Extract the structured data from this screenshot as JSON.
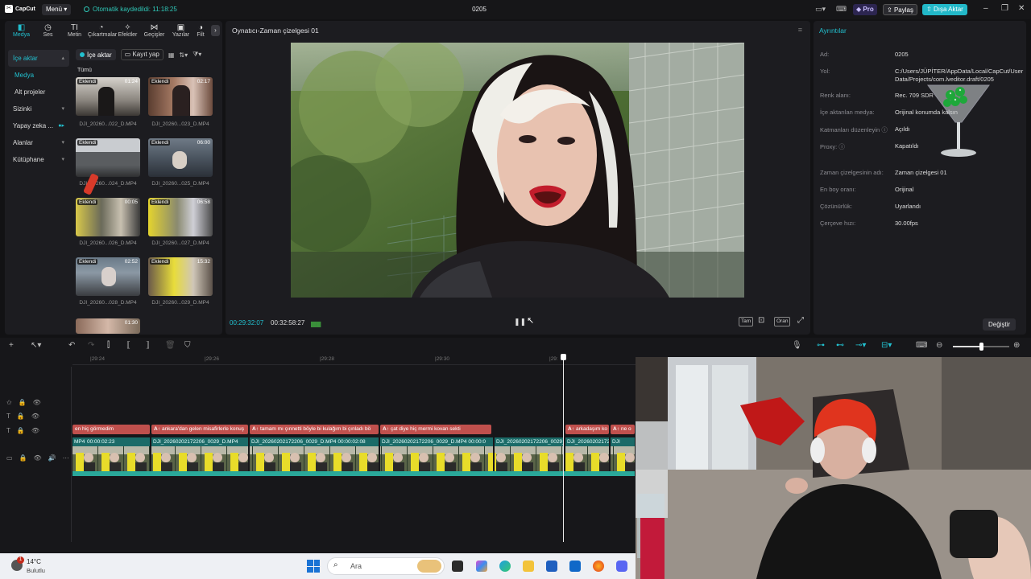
{
  "app": {
    "logo": "CapCut",
    "menu_label": "Menü",
    "autosave": "Otomatik kaydedildi: 11:18:25",
    "project_title": "0205",
    "pro_label": "Pro",
    "share_label": "Paylaş",
    "export_label": "Dışa Aktar"
  },
  "toolbar": {
    "items": [
      {
        "label": "Medya",
        "icon": "media-icon"
      },
      {
        "label": "Ses",
        "icon": "audio-icon"
      },
      {
        "label": "Metin",
        "icon": "text-icon"
      },
      {
        "label": "Çıkartmalar",
        "icon": "sticker-icon"
      },
      {
        "label": "Efektler",
        "icon": "effects-icon"
      },
      {
        "label": "Geçişler",
        "icon": "transitions-icon"
      },
      {
        "label": "Yazılar",
        "icon": "captions-icon"
      },
      {
        "label": "Filt",
        "icon": "filter-icon"
      }
    ]
  },
  "sidebar": {
    "items": [
      {
        "label": "İçe aktar"
      },
      {
        "label": "Medya"
      },
      {
        "label": "Alt projeler"
      },
      {
        "label": "Sizinki"
      },
      {
        "label": "Yapay zeka ..."
      },
      {
        "label": "Alanlar"
      },
      {
        "label": "Kütüphane"
      }
    ]
  },
  "media": {
    "import_label": "İçe aktar",
    "record_label": "Kayıt yap",
    "filter_label": "Tümü",
    "clips": [
      {
        "badge": "Eklendi",
        "duration": "01:24",
        "name": "DJI_20260...022_D.MP4"
      },
      {
        "badge": "Eklendi",
        "duration": "02:17",
        "name": "DJI_20260...023_D.MP4"
      },
      {
        "badge": "Eklendi",
        "duration": "",
        "name": "DJI_20260...024_D.MP4"
      },
      {
        "badge": "Eklendi",
        "duration": "06:00",
        "name": "DJI_20260...025_D.MP4"
      },
      {
        "badge": "Eklendi",
        "duration": "00:05",
        "name": "DJI_20260...026_D.MP4"
      },
      {
        "badge": "Eklendi",
        "duration": "06:58",
        "name": "DJI_20260...027_D.MP4"
      },
      {
        "badge": "Eklendi",
        "duration": "02:52",
        "name": "DJI_20260...028_D.MP4"
      },
      {
        "badge": "Eklendi",
        "duration": "15:32",
        "name": "DJI_20260...029_D.MP4"
      },
      {
        "badge": "",
        "duration": "01:30",
        "name": ""
      }
    ]
  },
  "player": {
    "title": "Oynatıcı-Zaman çizelgesi 01",
    "current_time": "00:29:32:07",
    "total_time": "00:32:58:27",
    "full_label": "Tam",
    "ratio_label": "Oran"
  },
  "details": {
    "title": "Ayrıntılar",
    "rows": [
      {
        "key": "Ad:",
        "value": "0205"
      },
      {
        "key": "Yol:",
        "value": "C:/Users/JÜPİTER/AppData/Local/CapCut/User Data/Projects/com.lveditor.draft/0205"
      },
      {
        "key": "Renk alanı:",
        "value": "Rec. 709 SDR"
      },
      {
        "key": "İçe aktarılan medya:",
        "value": "Orijinal konumda kalsın"
      },
      {
        "key": "Katmanları düzenleyin",
        "value": "Açıldı"
      },
      {
        "key": "Proxy:",
        "value": "Kapatıldı"
      },
      {
        "key": "Zaman çizelgesinin adı:",
        "value": "Zaman çizelgesi 01"
      },
      {
        "key": "En boy oranı:",
        "value": "Orijinal"
      },
      {
        "key": "Çözünürlük:",
        "value": "Uyarlandı"
      },
      {
        "key": "Çerçeve hızı:",
        "value": "30.00fps"
      }
    ],
    "change_label": "Değiştir"
  },
  "timeline": {
    "ruler": [
      "|29:24",
      "|29:26",
      "|29:28",
      "|29:30",
      "|29:"
    ],
    "captions": [
      {
        "text": "en hiç görmedim"
      },
      {
        "text": "ankara'dan gelen misafirlerle konuş"
      },
      {
        "text": "tamam mı çınnetti böyle bi kulağım bi çınladı bö"
      },
      {
        "text": "çat diye hiç mermi kovan sekti"
      },
      {
        "text": "arkadaşım ko"
      },
      {
        "text": "ne o"
      }
    ],
    "video_labels": [
      {
        "text": "MP4"
      },
      {
        "text": "00:00:02:23"
      },
      {
        "text": "DJI_20260202172206_0029_D.MP4"
      },
      {
        "text": "DJI_20260202172206_0029_D.MP4   00:00:02:08"
      },
      {
        "text": "DJI_20260202172206_0029_D.MP4   00:00:0"
      },
      {
        "text": "DJI_20260202172206_0029_D.MP4"
      },
      {
        "text": "DJI_20260202172206_0029_D.MP4"
      },
      {
        "text": "DJI"
      }
    ]
  },
  "taskbar": {
    "temperature": "14°C",
    "weather": "Bulutlu",
    "notification_count": "1",
    "search_placeholder": "Ara"
  }
}
